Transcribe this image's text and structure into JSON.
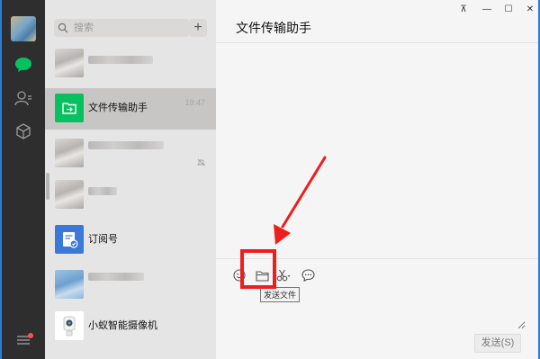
{
  "search": {
    "placeholder": "搜索"
  },
  "add_label": "+",
  "chats": [
    {
      "name": "",
      "time": ""
    },
    {
      "name": "文件传输助手",
      "time": "19:47"
    },
    {
      "name": "",
      "time": ""
    },
    {
      "name": "",
      "time": ""
    },
    {
      "name": "订阅号",
      "time": ""
    },
    {
      "name": "",
      "time": ""
    },
    {
      "name": "小蚁智能摄像机",
      "time": ""
    }
  ],
  "main": {
    "title": "文件传输助手",
    "window_controls": {
      "pin": "⊼",
      "minimize": "—",
      "maximize": "☐",
      "close": "✕"
    },
    "tooltip": "发送文件",
    "send_label": "发送(S)"
  },
  "colors": {
    "accent_green": "#07c160",
    "highlight_red": "#ef1d1d",
    "nav_bg": "#2e2e2e"
  },
  "icons": [
    "chat-icon",
    "contacts-icon",
    "favorites-icon",
    "menu-icon",
    "search-icon",
    "emoji-icon",
    "folder-icon",
    "scissors-icon",
    "chat-bubble-icon"
  ]
}
